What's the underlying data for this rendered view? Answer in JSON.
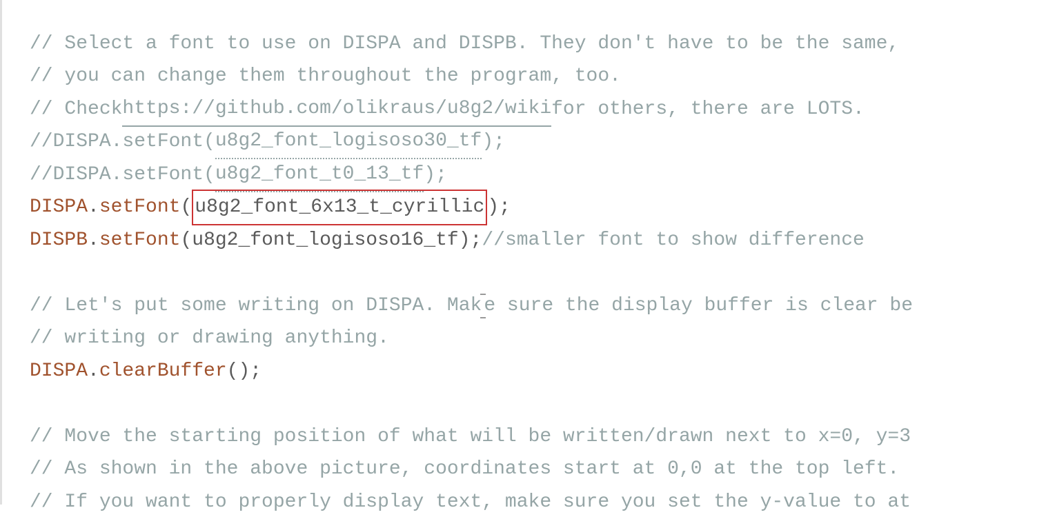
{
  "code": {
    "line1": {
      "comment": "// Select a font to use on DISPA and DISPB. They don't have to be the same,"
    },
    "line2": {
      "comment": "// you can change them throughout the program, too."
    },
    "line3": {
      "comment_prefix": "// Check ",
      "url": "https://github.com/olikraus/u8g2/wiki",
      "comment_suffix": " for others, there are LOTS."
    },
    "line4": {
      "comment_prefix": "//DISPA.setFont(",
      "arg": "u8g2_font_logisoso30_tf",
      "comment_suffix": " );"
    },
    "line5": {
      "comment_prefix": "//DISPA.setFont(",
      "arg": "u8g2_font_t0_13_tf",
      "comment_suffix": ");"
    },
    "line6": {
      "obj": "DISPA",
      "dot": ".",
      "method": "setFont",
      "open": "(",
      "arg": "u8g2_font_6x13_t_cyrillic",
      "close": " );"
    },
    "line7": {
      "obj": "DISPB",
      "dot": ".",
      "method": "setFont",
      "open": "(",
      "arg": "u8g2_font_logisoso16_tf ",
      "close": "); ",
      "comment": "//smaller font to show difference"
    },
    "line9": {
      "comment_prefix": "// Let's put some writing on DISPA. Mak",
      "comment_suffix": "e sure the display buffer is clear be"
    },
    "line10": {
      "comment": "// writing or drawing anything."
    },
    "line11": {
      "obj": "DISPA",
      "dot": ".",
      "method": "clearBuffer",
      "close": "();"
    },
    "line13": {
      "comment": "// Move the starting position of what will be written/drawn next to x=0, y=3"
    },
    "line14": {
      "comment": "// As shown in the above picture, coordinates start at 0,0 at the top left."
    },
    "line15": {
      "comment": "// If you want to properly display text, make sure you set the y-value to at"
    }
  }
}
